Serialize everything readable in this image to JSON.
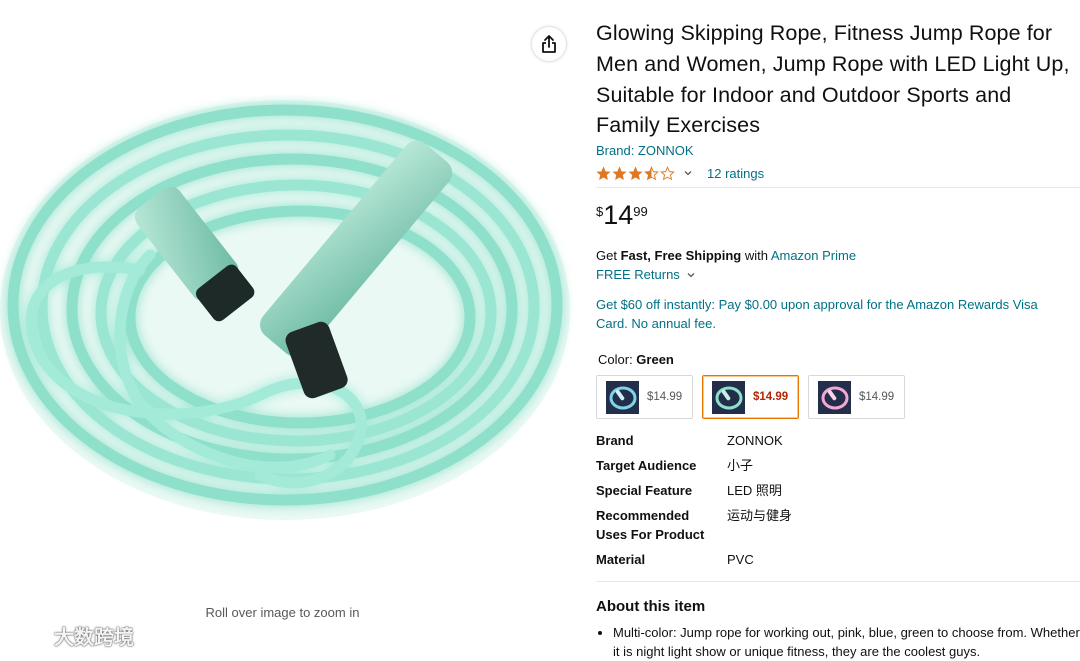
{
  "image_panel": {
    "zoom_hint": "Roll over image to zoom in",
    "watermark_text": "大数跨境",
    "share_icon": "share-icon"
  },
  "product": {
    "title": "Glowing Skipping Rope, Fitness Jump Rope for Men and Women, Jump Rope with LED Light Up, Suitable for Indoor and Outdoor Sports and Family Exercises",
    "brand_link": "Brand: ZONNOK",
    "rating_stars": 3.5,
    "rating_count": "12 ratings",
    "price": {
      "symbol": "$",
      "whole": "14",
      "fraction": "99"
    },
    "shipping": {
      "prefix": "Get ",
      "bold": "Fast, Free Shipping",
      "middle": " with ",
      "link": "Amazon Prime"
    },
    "returns": "FREE Returns",
    "promo": "Get $60 off instantly: Pay $0.00 upon approval for the Amazon Rewards Visa Card. No annual fee.",
    "color": {
      "label": "Color: ",
      "value": "Green"
    },
    "variants": [
      {
        "price": "$14.99",
        "color": "blue",
        "selected": false
      },
      {
        "price": "$14.99",
        "color": "green",
        "selected": true
      },
      {
        "price": "$14.99",
        "color": "pink",
        "selected": false
      }
    ],
    "specs": [
      {
        "key": "Brand",
        "value": "ZONNOK"
      },
      {
        "key": "Target Audience",
        "value": "小子"
      },
      {
        "key": "Special Feature",
        "value": "LED 照明"
      },
      {
        "key_line1": "Recommended",
        "key_line2": "Uses For Product",
        "value": "运动与健身"
      },
      {
        "key": "Material",
        "value": "PVC"
      }
    ],
    "about_heading": "About this item",
    "bullets": [
      "Multi-color: Jump rope for working out, pink, blue, green to choose from. Whether it is night light show or unique fitness, they are the coolest guys."
    ]
  },
  "colors": {
    "link": "#007185",
    "price_red": "#b12704",
    "star": "#de7921",
    "selected_border": "#e77600",
    "rope_glow": "#9be8d6"
  }
}
